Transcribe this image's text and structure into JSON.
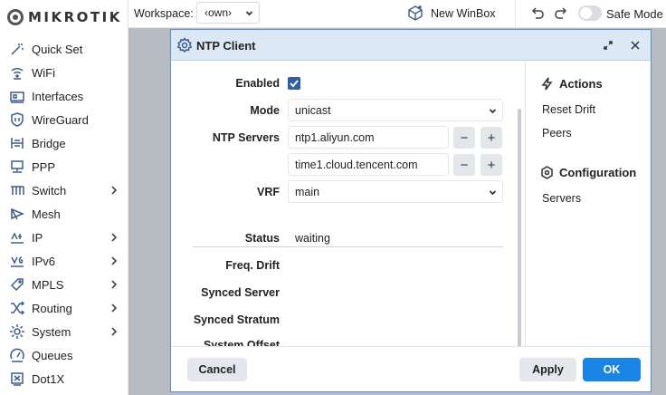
{
  "brand": {
    "logo_text": "MIKROTIK"
  },
  "sidebar": {
    "items": [
      {
        "label": "Quick Set",
        "icon": "magic-wand-icon",
        "has_submenu": false
      },
      {
        "label": "WiFi",
        "icon": "wifi-icon",
        "has_submenu": false
      },
      {
        "label": "Interfaces",
        "icon": "interfaces-icon",
        "has_submenu": false
      },
      {
        "label": "WireGuard",
        "icon": "wireguard-shield-icon",
        "has_submenu": false
      },
      {
        "label": "Bridge",
        "icon": "bridge-icon",
        "has_submenu": false
      },
      {
        "label": "PPP",
        "icon": "ppp-icon",
        "has_submenu": false
      },
      {
        "label": "Switch",
        "icon": "switch-icon",
        "has_submenu": true
      },
      {
        "label": "Mesh",
        "icon": "mesh-icon",
        "has_submenu": false
      },
      {
        "label": "IP",
        "icon": "ipv4-icon",
        "has_submenu": true
      },
      {
        "label": "IPv6",
        "icon": "ipv6-icon",
        "has_submenu": true
      },
      {
        "label": "MPLS",
        "icon": "mpls-tag-icon",
        "has_submenu": true
      },
      {
        "label": "Routing",
        "icon": "routing-icon",
        "has_submenu": true
      },
      {
        "label": "System",
        "icon": "system-gear-icon",
        "has_submenu": true
      },
      {
        "label": "Queues",
        "icon": "queues-gauge-icon",
        "has_submenu": false
      },
      {
        "label": "Dot1X",
        "icon": "dot1x-icon",
        "has_submenu": false
      }
    ]
  },
  "toolbar": {
    "workspace_label": "Workspace:",
    "workspace_value": "‹own›",
    "new_winbox_label": "New WinBox",
    "safe_mode_label": "Safe Mode",
    "safe_mode_on": false
  },
  "dialog": {
    "title": "NTP Client",
    "form": {
      "enabled_label": "Enabled",
      "enabled_checked": true,
      "mode_label": "Mode",
      "mode_value": "unicast",
      "ntp_servers_label": "NTP Servers",
      "ntp_servers": [
        "ntp1.aliyun.com",
        "time1.cloud.tencent.com"
      ],
      "vrf_label": "VRF",
      "vrf_value": "main",
      "status_label": "Status",
      "status_value": "waiting",
      "freq_drift_label": "Freq. Drift",
      "synced_server_label": "Synced Server",
      "synced_stratum_label": "Synced Stratum",
      "system_offset_label": "System Offset"
    },
    "actions": {
      "heading": "Actions",
      "items": [
        "Reset Drift",
        "Peers"
      ]
    },
    "configuration": {
      "heading": "Configuration",
      "items": [
        "Servers"
      ]
    },
    "footer": {
      "cancel_label": "Cancel",
      "apply_label": "Apply",
      "ok_label": "OK"
    }
  },
  "colors": {
    "accent": "#1a84e6",
    "icon": "#3b5d8c",
    "dialog_header": "#dce8f6",
    "workspace_bg": "#b7bcc3"
  }
}
